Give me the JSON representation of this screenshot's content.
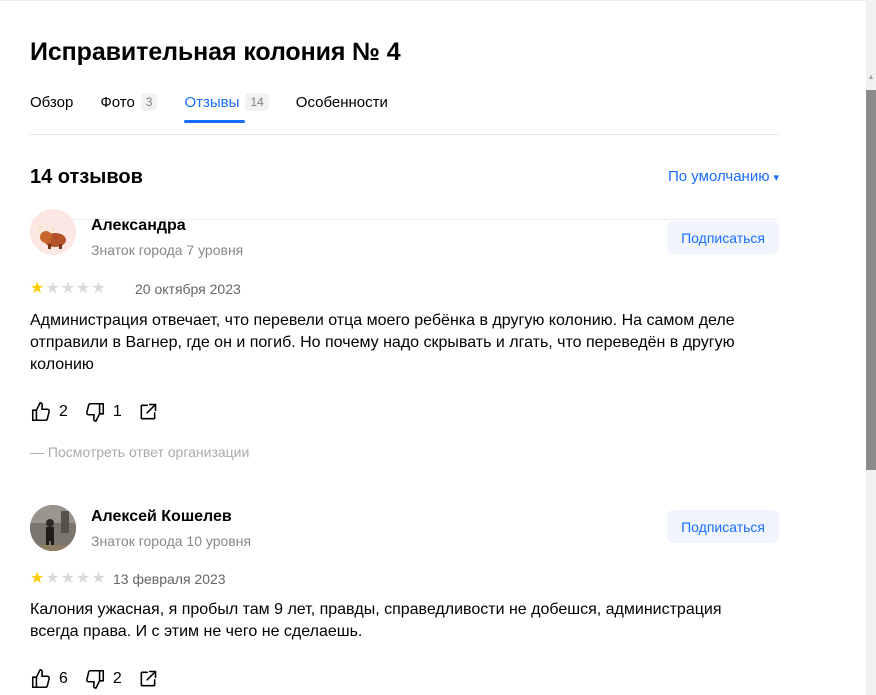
{
  "org": {
    "title": "Исправительная колония № 4"
  },
  "tabs": [
    {
      "label": "Обзор",
      "count": ""
    },
    {
      "label": "Фото",
      "count": "3"
    },
    {
      "label": "Отзывы",
      "count": "14"
    },
    {
      "label": "Особенности",
      "count": ""
    }
  ],
  "reviews_header": {
    "title": "14 отзывов",
    "sort_label": "По умолчанию",
    "sort_caret": "▾"
  },
  "reviews": [
    {
      "author": "Александра",
      "level": "Знаток города 7 уровня",
      "subscribe_label": "Подписаться",
      "rating": 1,
      "date": "20 октября 2023",
      "text": "Администрация отвечает, что перевели отца моего ребёнка в другую колонию. На самом деле отправили в Вагнер, где он и погиб. Но почему надо скрывать и лгать, что переведён в другую колонию",
      "likes": "2",
      "dislikes": "1",
      "answer_link": "— Посмотреть ответ организации"
    },
    {
      "author": "Алексей Кошелев",
      "level": "Знаток города 10 уровня",
      "subscribe_label": "Подписаться",
      "rating": 1,
      "date": "13 февраля 2023",
      "text": "Калония ужасная, я пробыл там 9 лет, правды, справедливости не добешся, администрация всегда права. И с этим не чего не сделаешь.",
      "likes": "6",
      "dislikes": "2"
    }
  ],
  "icons": {
    "like": "thumb-up-icon",
    "dislike": "thumb-down-icon",
    "share": "share-icon",
    "star": "star-icon"
  },
  "colors": {
    "accent": "#196dff",
    "star_on": "#ffcc00",
    "star_off": "#d9d9d9",
    "subscribe_bg": "#f0f4fc"
  }
}
